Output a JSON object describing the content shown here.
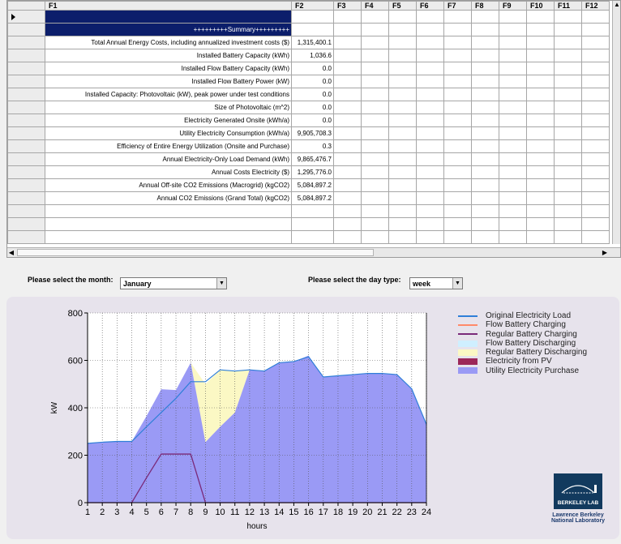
{
  "grid": {
    "columns": [
      "F1",
      "F2",
      "F3",
      "F4",
      "F5",
      "F6",
      "F7",
      "F8",
      "F9",
      "F10",
      "F11",
      "F12"
    ],
    "summary_label": "+++++++++Summary+++++++++",
    "rows": [
      {
        "label": "Total Annual Energy Costs, including annualized investment costs ($)",
        "value": "1,315,400.1"
      },
      {
        "label": "Installed Battery Capacity (kWh)",
        "value": "1,036.6"
      },
      {
        "label": "Installed Flow Battery Capacity (kWh)",
        "value": "0.0"
      },
      {
        "label": "Installed Flow Battery Power (kW)",
        "value": "0.0"
      },
      {
        "label": "Installed Capacity: Photovoltaic (kW), peak power under test conditions",
        "value": "0.0"
      },
      {
        "label": "Size of Photovoltaic (m^2)",
        "value": "0.0"
      },
      {
        "label": "Electricity Generated Onsite (kWh/a)",
        "value": "0.0"
      },
      {
        "label": "Utility Electricity Consumption (kWh/a)",
        "value": "9,905,708.3"
      },
      {
        "label": "Efficiency of Entire Energy Utilization (Onsite and Purchase)",
        "value": "0.3"
      },
      {
        "label": "Annual Electricity-Only Load Demand (kWh)",
        "value": "9,865,476.7"
      },
      {
        "label": "Annual Costs Electricity ($)",
        "value": "1,295,776.0"
      },
      {
        "label": "Annual Off-site CO2 Emissions (Macrogrid) (kgCO2)",
        "value": "5,084,897.2"
      },
      {
        "label": "Annual CO2 Emissions (Grand Total) (kgCO2)",
        "value": "5,084,897.2"
      }
    ]
  },
  "month_select": {
    "label": "Please select the month:",
    "value": "January"
  },
  "daytype_select": {
    "label": "Please select the day type:",
    "value": "week"
  },
  "chart_data": {
    "type": "area",
    "xlabel": "hours",
    "ylabel": "kW",
    "x": [
      1,
      2,
      3,
      4,
      5,
      6,
      7,
      8,
      9,
      10,
      11,
      12,
      13,
      14,
      15,
      16,
      17,
      18,
      19,
      20,
      21,
      22,
      23,
      24
    ],
    "xlim": [
      1,
      24
    ],
    "ylim": [
      0,
      800
    ],
    "yticks": [
      0,
      200,
      400,
      600,
      800
    ],
    "grid": "vertical-dotted",
    "legend_position": "right",
    "series": [
      {
        "name": "Original Electricity Load",
        "kind": "line",
        "color": "#2f7fd8",
        "values": [
          250,
          255,
          258,
          258,
          320,
          380,
          440,
          510,
          510,
          560,
          555,
          560,
          555,
          590,
          595,
          615,
          530,
          535,
          540,
          545,
          545,
          540,
          480,
          330
        ]
      },
      {
        "name": "Flow Battery Charging",
        "kind": "line",
        "color": "#ff8a6a",
        "values": [
          0,
          0,
          0,
          0,
          0,
          0,
          0,
          0,
          0,
          0,
          0,
          0,
          0,
          0,
          0,
          0,
          0,
          0,
          0,
          0,
          0,
          0,
          0,
          0
        ]
      },
      {
        "name": "Regular Battery Charging",
        "kind": "line",
        "color": "#7a2a7a",
        "values": [
          0,
          0,
          0,
          0,
          105,
          205,
          205,
          205,
          0,
          0,
          0,
          0,
          0,
          0,
          0,
          0,
          0,
          0,
          0,
          0,
          0,
          0,
          0,
          0
        ]
      },
      {
        "name": "Flow Battery Discharging",
        "kind": "area",
        "color": "#cfefff",
        "values": [
          0,
          0,
          0,
          0,
          0,
          0,
          0,
          0,
          0,
          0,
          0,
          0,
          0,
          0,
          0,
          0,
          0,
          0,
          0,
          0,
          0,
          0,
          0,
          0
        ]
      },
      {
        "name": "Regular Battery Discharging",
        "kind": "area",
        "color": "#fbf8c4",
        "values": [
          0,
          0,
          0,
          0,
          0,
          0,
          0,
          0,
          245,
          240,
          175,
          0,
          0,
          0,
          0,
          0,
          0,
          0,
          0,
          0,
          0,
          0,
          0,
          0
        ]
      },
      {
        "name": "Electricity from PV",
        "kind": "area",
        "color": "#9c2759",
        "values": [
          0,
          0,
          0,
          0,
          0,
          0,
          0,
          0,
          0,
          0,
          0,
          0,
          0,
          0,
          0,
          0,
          0,
          0,
          0,
          0,
          0,
          0,
          0,
          0
        ]
      },
      {
        "name": "Utility Electricity Purchase",
        "kind": "area",
        "color": "#9a9af5",
        "values": [
          250,
          255,
          258,
          258,
          365,
          478,
          475,
          590,
          255,
          320,
          380,
          560,
          555,
          590,
          595,
          620,
          530,
          535,
          540,
          545,
          545,
          540,
          480,
          330
        ]
      }
    ]
  },
  "logo": {
    "badge": "BERKELEY LAB",
    "line1": "Lawrence Berkeley",
    "line2": "National Laboratory"
  }
}
